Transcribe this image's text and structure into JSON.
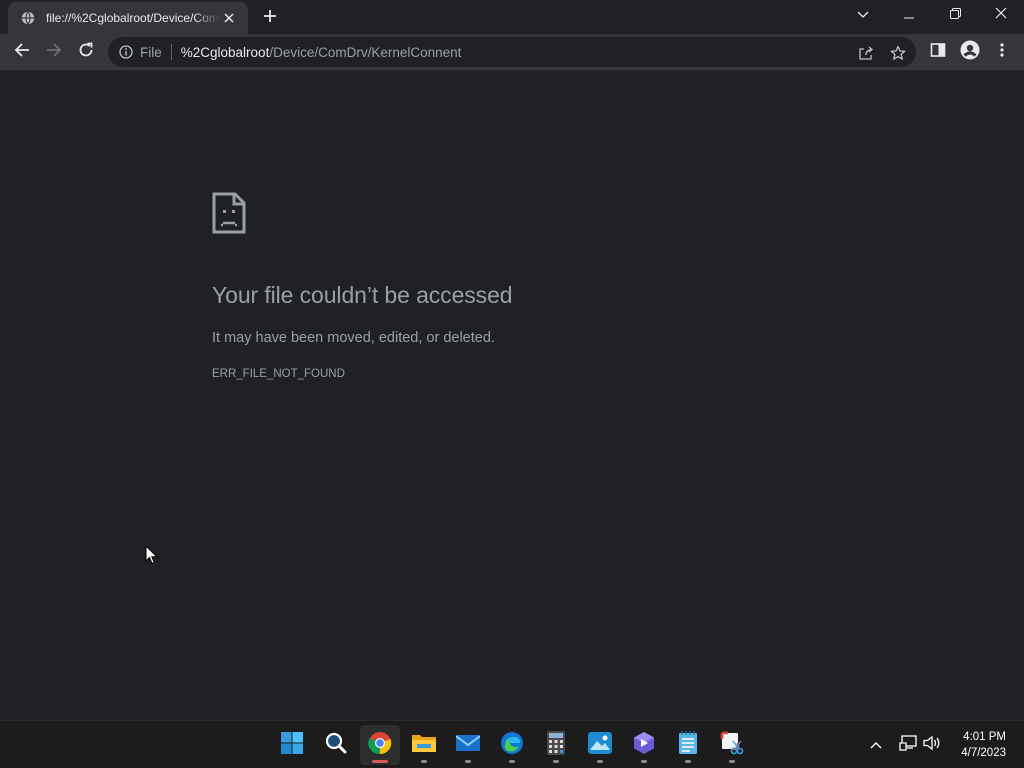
{
  "browser": {
    "tab": {
      "title": "file://%2Cglobalroot/Device/ComDrv/KernelConnent"
    },
    "address": {
      "scheme_label": "File",
      "host": "%2Cglobalroot",
      "path": "/Device/ComDrv/KernelConnent"
    },
    "icons": {
      "tab_favicon": "globe-icon",
      "tab_close": "close-icon",
      "new_tab": "plus-icon",
      "tab_search": "chevron-down-icon",
      "minimize": "minimize-icon",
      "restore": "restore-icon",
      "close_window": "close-icon",
      "back": "back-arrow-icon",
      "forward": "forward-arrow-icon",
      "reload": "reload-icon",
      "site_info": "info-icon",
      "share": "share-icon",
      "bookmark": "star-icon",
      "side_panel": "side-panel-icon",
      "profile": "profile-icon",
      "menu": "kebab-menu-icon"
    }
  },
  "error_page": {
    "title": "Your file couldn’t be accessed",
    "description": "It may have been moved, edited, or deleted.",
    "code": "ERR_FILE_NOT_FOUND"
  },
  "taskbar": {
    "apps": [
      {
        "name": "start-icon",
        "active": false
      },
      {
        "name": "search-icon",
        "active": false
      },
      {
        "name": "chrome-icon",
        "active": true
      },
      {
        "name": "file-explorer-icon",
        "active": false
      },
      {
        "name": "mail-icon",
        "active": false
      },
      {
        "name": "edge-icon",
        "active": false
      },
      {
        "name": "calculator-icon",
        "active": false
      },
      {
        "name": "photos-icon",
        "active": false
      },
      {
        "name": "app-icon",
        "active": false
      },
      {
        "name": "notepad-icon",
        "active": false
      },
      {
        "name": "snipping-tool-icon",
        "active": false
      }
    ],
    "tray": {
      "time": "4:01 PM",
      "date": "4/7/2023"
    }
  },
  "colors": {
    "page_bg": "#202124",
    "toolbar_bg": "#35363a",
    "text_primary": "#e8eaed",
    "text_secondary": "#9aa0a6",
    "taskbar_bg": "#1c1c1c",
    "active_indicator": "#d85a5a"
  }
}
